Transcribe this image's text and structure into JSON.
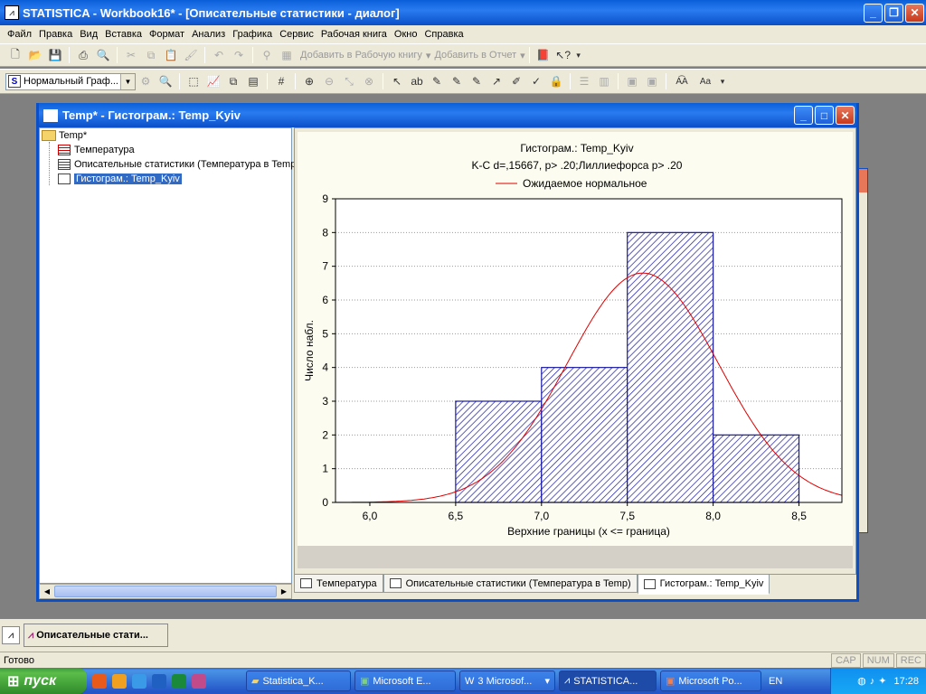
{
  "app": {
    "title": "STATISTICA - Workbook16* - [Описательные статистики - диалог]",
    "icon": "statistica-icon"
  },
  "menu": [
    "Файл",
    "Правка",
    "Вид",
    "Вставка",
    "Формат",
    "Анализ",
    "Графика",
    "Сервис",
    "Рабочая книга",
    "Окно",
    "Справка"
  ],
  "toolbar1": {
    "add_workbook": "Добавить в Рабочую книгу",
    "add_report": "Добавить в Отчет"
  },
  "toolbar2": {
    "graph_style": "Нормальный Граф...",
    "graph_style_icon": "S"
  },
  "workbook_window": {
    "title": "Temp* - Гистограм.: Temp_Kyiv",
    "tree": {
      "root": "Temp*",
      "items": [
        "Температура",
        "Описательные статистики (Температура в Temp)",
        "Гистограм.: Temp_Kyiv"
      ]
    },
    "tabs": [
      "Температура",
      "Описательные статистики (Температура в Temp)",
      "Гистограм.: Temp_Kyiv"
    ]
  },
  "chart_data": {
    "type": "bar",
    "title": "Гистограм.: Temp_Kyiv",
    "subtitle": "K-C d=,15667, p> .20;Лиллиефорса p> .20",
    "legend": "Ожидаемое нормальное",
    "xlabel": "Верхние границы (x <= граница)",
    "ylabel": "Число набл.",
    "xlim": [
      5.8,
      8.75
    ],
    "ylim": [
      0,
      9
    ],
    "xticks": [
      "6,0",
      "6,5",
      "7,0",
      "7,5",
      "8,0",
      "8,5"
    ],
    "xtick_values": [
      6.0,
      6.5,
      7.0,
      7.5,
      8.0,
      8.5
    ],
    "yticks": [
      0,
      1,
      2,
      3,
      4,
      5,
      6,
      7,
      8,
      9
    ],
    "bins": [
      {
        "from": 6.5,
        "to": 7.0,
        "count": 3
      },
      {
        "from": 7.0,
        "to": 7.5,
        "count": 4
      },
      {
        "from": 7.5,
        "to": 8.0,
        "count": 8
      },
      {
        "from": 8.0,
        "to": 8.5,
        "count": 2
      }
    ],
    "normal_curve": {
      "mean": 7.59,
      "sd": 0.44,
      "peak": 6.8
    },
    "bar_color": "#1a1aa0",
    "curve_color": "#e00000"
  },
  "minimized": {
    "label": "Описательные стати..."
  },
  "status": {
    "text": "Готово",
    "cells": [
      "CAP",
      "NUM",
      "REC"
    ]
  },
  "taskbar": {
    "start": "пуск",
    "tasks": [
      "Statistica_K...",
      "Microsoft E...",
      "3 Microsof...",
      "STATISTICA...",
      "Microsoft Po..."
    ],
    "lang": "EN",
    "time": "17:28"
  }
}
